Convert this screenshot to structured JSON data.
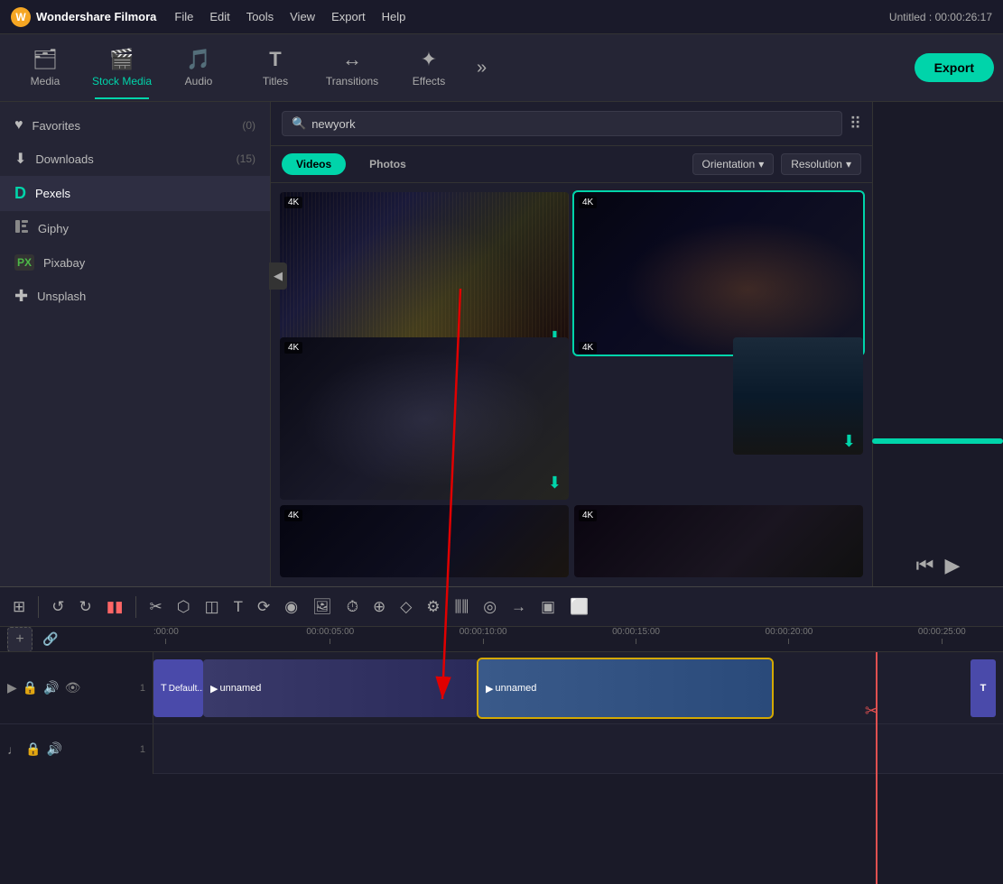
{
  "app": {
    "name": "Wondershare Filmora",
    "title": "Untitled : 00:00:26:17"
  },
  "menu": {
    "items": [
      "File",
      "Edit",
      "Tools",
      "View",
      "Export",
      "Help"
    ]
  },
  "nav": {
    "items": [
      {
        "id": "media",
        "label": "Media",
        "icon": "🗂"
      },
      {
        "id": "stock-media",
        "label": "Stock Media",
        "icon": "🎬",
        "active": true
      },
      {
        "id": "audio",
        "label": "Audio",
        "icon": "♪"
      },
      {
        "id": "titles",
        "label": "Titles",
        "icon": "T"
      },
      {
        "id": "transitions",
        "label": "Transitions",
        "icon": "↔"
      },
      {
        "id": "effects",
        "label": "Effects",
        "icon": "✦"
      }
    ],
    "more_label": "»",
    "export_label": "Export"
  },
  "sidebar": {
    "items": [
      {
        "id": "favorites",
        "label": "Favorites",
        "icon": "♥",
        "count": "(0)"
      },
      {
        "id": "downloads",
        "label": "Downloads",
        "icon": "⬇",
        "count": "(15)"
      },
      {
        "id": "pexels",
        "label": "Pexels",
        "icon": "D",
        "active": true
      },
      {
        "id": "giphy",
        "label": "Giphy",
        "icon": "G"
      },
      {
        "id": "pixabay",
        "label": "Pixabay",
        "icon": "PX"
      },
      {
        "id": "unsplash",
        "label": "Unsplash",
        "icon": "✚"
      }
    ]
  },
  "search": {
    "placeholder": "newyork",
    "value": "newyork"
  },
  "filters": {
    "type_active": "Videos",
    "type_inactive": "Photos",
    "orientation_label": "Orientation",
    "resolution_label": "Resolution"
  },
  "media_grid": {
    "items": [
      {
        "id": 1,
        "badge": "4K",
        "selected": false,
        "download": true
      },
      {
        "id": 2,
        "badge": "4K",
        "selected": true,
        "download": false
      },
      {
        "id": 3,
        "badge": "4K",
        "selected": false,
        "download": true
      },
      {
        "id": 4,
        "badge": "4K",
        "selected": false,
        "portrait": true,
        "download": true
      },
      {
        "id": 5,
        "badge": "4K",
        "selected": false,
        "download": false
      },
      {
        "id": 6,
        "badge": "4K",
        "selected": false,
        "download": false
      }
    ]
  },
  "timeline": {
    "toolbar": {
      "layout_icon": "⊞",
      "undo_icon": "↺",
      "redo_icon": "↻",
      "delete_icon": "▮▮",
      "cut_icon": "✂",
      "crop_icon": "◯",
      "trim_icon": "◫",
      "text_icon": "T+",
      "loop_icon": "⟳",
      "color_icon": "◉",
      "photo_icon": "⬛",
      "timer_icon": "⏱",
      "snap_icon": "⊕",
      "mask_icon": "◇",
      "adjust_icon": "⚙",
      "audio_icon": "⫼",
      "stabilize_icon": "◎",
      "speed_icon": "⟹",
      "color2_icon": "▣"
    },
    "ruler": {
      "marks": [
        "00:00",
        "00:00:05:00",
        "00:00:10:00",
        "00:00:15:00",
        "00:00:20:00",
        "00:00:25:00"
      ]
    },
    "clips": {
      "text_start": "Default...",
      "video1": "unnamed",
      "video2": "unnamed",
      "text_end": "T"
    }
  }
}
